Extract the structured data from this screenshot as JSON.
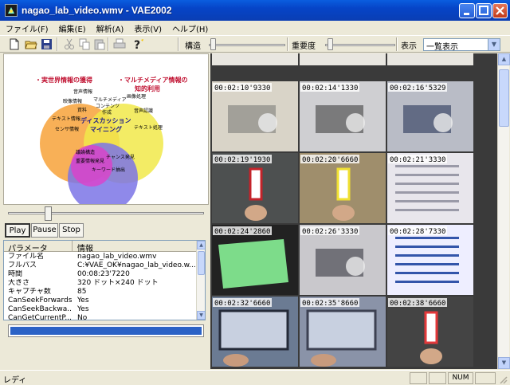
{
  "window": {
    "title": "nagao_lab_video.wmv - VAE2002"
  },
  "menu": [
    "ファイル(F)",
    "編集(E)",
    "解析(A)",
    "表示(V)",
    "ヘルプ(H)"
  ],
  "toolbar": {
    "structure_label": "構造",
    "importance_label": "重要度",
    "display_label": "表示",
    "display_value": "一覧表示"
  },
  "diagram": {
    "circle_labels": [
      "・実世界情報の獲得",
      "・マルチメディア情報の",
      "知的利用"
    ],
    "items": [
      "音声情報",
      "映像情報",
      "資料",
      "テキスト情報",
      "センサ情報",
      "マルチメディア",
      "コンテンツ",
      "作成",
      "画像処理",
      "音声認識",
      "テキスト処理",
      "ディスカッション",
      "マイニング",
      "議論構造",
      "重要情報発見",
      "チャンス発見",
      "キーワード抽出"
    ]
  },
  "playback": {
    "play": "Play",
    "pause": "Pause",
    "stop": "Stop",
    "position": 0.2
  },
  "properties": {
    "headers": [
      "パラメータ",
      "情報"
    ],
    "rows": [
      [
        "ファイル名",
        "nagao_lab_video.wmv"
      ],
      [
        "フルパス",
        "C:¥VAE_OK¥nagao_lab_video.w..."
      ],
      [
        "時間",
        "00:08:23'7220"
      ],
      [
        "大きさ",
        "320 ドット×240 ドット"
      ],
      [
        "キャプチャ数",
        "85"
      ],
      [
        "CanSeekForwards",
        "Yes"
      ],
      [
        "CanSeekBackwa...",
        "Yes"
      ],
      [
        "CanGetCurrentP...",
        "No"
      ]
    ]
  },
  "progress": 1.0,
  "thumbnails": [
    {
      "time": "",
      "kind": "partial"
    },
    {
      "time": "",
      "kind": "partial"
    },
    {
      "time": "",
      "kind": "partial"
    },
    {
      "time": "00:02:10'9330",
      "kind": "room"
    },
    {
      "time": "00:02:14'1330",
      "kind": "devices"
    },
    {
      "time": "00:02:16'5329",
      "kind": "lab"
    },
    {
      "time": "00:02:19'1930",
      "kind": "card-red"
    },
    {
      "time": "00:02:20'6660",
      "kind": "card-yellow"
    },
    {
      "time": "00:02:21'3330",
      "kind": "whiteboard"
    },
    {
      "time": "00:02:24'2860",
      "kind": "green-screen"
    },
    {
      "time": "00:02:26'3330",
      "kind": "projector"
    },
    {
      "time": "00:02:28'7330",
      "kind": "slides"
    },
    {
      "time": "00:02:32'6660",
      "kind": "laptop"
    },
    {
      "time": "00:02:35'8660",
      "kind": "laptop2"
    },
    {
      "time": "00:02:38'6660",
      "kind": "cards"
    }
  ],
  "status": {
    "text": "レディ",
    "num": "NUM"
  }
}
